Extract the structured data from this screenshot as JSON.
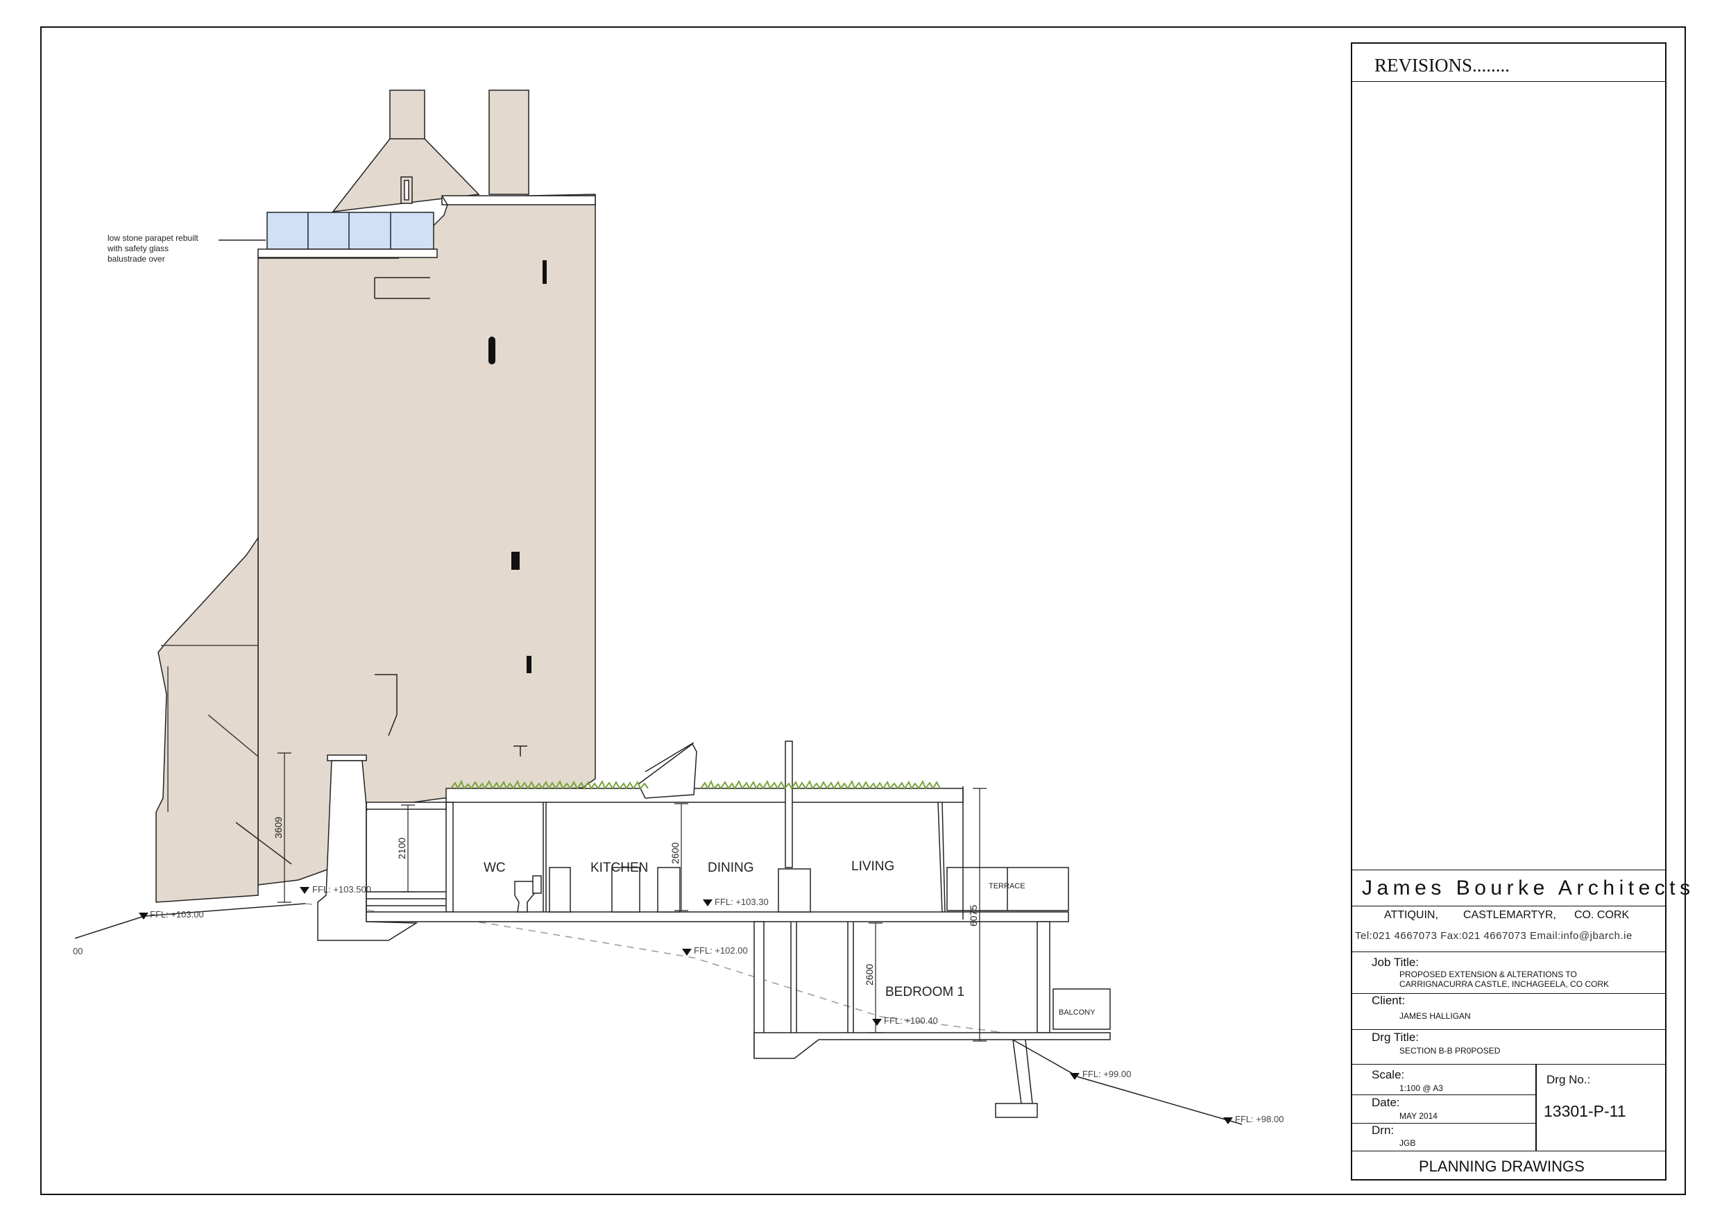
{
  "drawing": {
    "annotation": [
      "low stone parapet rebuilt",
      "with safety glass",
      "balustrade over"
    ],
    "rooms": {
      "wc": "WC",
      "kitchen": "KITCHEN",
      "dining": "DINING",
      "living": "LIVING",
      "terrace": "TERRACE",
      "bedroom": "BEDROOM 1",
      "balcony": "BALCONY"
    },
    "levels": {
      "l103_00": "FFL: +103.00",
      "l103_50": "FFL: +103.500",
      "l103_30": "FFL: +103.30",
      "l102_00": "FFL: +102.00",
      "l100_40": "FFL: +100.40",
      "l99_00": "FFL: +99.00",
      "l98_00": "FFL: +98.00",
      "edge": "00"
    },
    "dimensions": {
      "d3609": "3609",
      "d2100": "2100",
      "d2600a": "2600",
      "d2600b": "2600",
      "d6075": "6075"
    }
  },
  "title_block": {
    "revisions": "REVISIONS........",
    "firm": "James Bourke Architects",
    "address": [
      "ATTIQUIN,",
      "CASTLEMARTYR,",
      "CO. CORK"
    ],
    "contact": "Tel:021  4667073  Fax:021  4667073  Email:info@jbarch.ie",
    "job_title_label": "Job Title:",
    "job_title": [
      "PROPOSED EXTENSION  & ALTERATIONS TO",
      "CARRIGNACURRA CASTLE, INCHAGEELA, CO CORK"
    ],
    "client_label": "Client:",
    "client": "JAMES HALLIGAN",
    "drg_title_label": "Drg Title:",
    "drg_title": "SECTION B-B PR0POSED",
    "scale_label": "Scale:",
    "scale": "1:100 @ A3",
    "date_label": "Date:",
    "date": "MAY 2014",
    "drn_label": "Drn:",
    "drn": "JGB",
    "drg_no_label": "Drg No.:",
    "drg_no": "13301-P-11",
    "footer": "PLANNING DRAWINGS"
  },
  "colors": {
    "stone": "#e3d9ce",
    "glass": "#cfe0f7",
    "grass": "#7aa33a",
    "line": "#111111"
  }
}
